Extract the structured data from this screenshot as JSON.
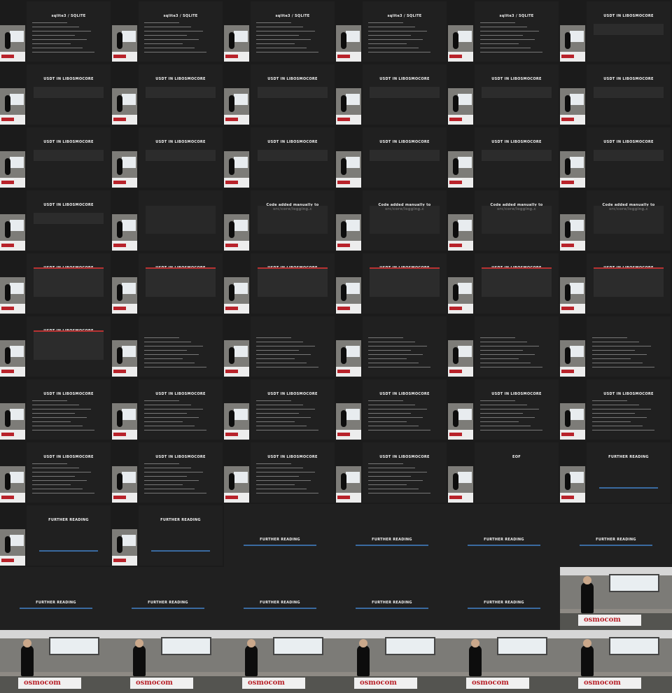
{
  "colors": {
    "background": "#111111",
    "slide": "#202020",
    "code_block": "#2c2c2c",
    "accent_red": "#b8222a",
    "link_blue": "#3a6aa0"
  },
  "labels": {
    "sqlite": "sqlite3 / SQLITE",
    "libosmocore": "USDT IN LIBOSMOCORE",
    "manual": "Code added manually to src/core/logging.c",
    "eof": "EOF",
    "further": "FURTHER READING",
    "event_logo": "osmocom"
  },
  "grid": {
    "columns": 6,
    "rows": 11,
    "cells": [
      {
        "type": "inset",
        "slide": "sqlite"
      },
      {
        "type": "inset",
        "slide": "sqlite"
      },
      {
        "type": "inset",
        "slide": "sqlite"
      },
      {
        "type": "inset",
        "slide": "sqlite"
      },
      {
        "type": "inset",
        "slide": "sqlite"
      },
      {
        "type": "inset",
        "slide": "libosmocore"
      },
      {
        "type": "inset",
        "slide": "libosmocore"
      },
      {
        "type": "inset",
        "slide": "libosmocore"
      },
      {
        "type": "inset",
        "slide": "libosmocore"
      },
      {
        "type": "inset",
        "slide": "libosmocore"
      },
      {
        "type": "inset",
        "slide": "libosmocore"
      },
      {
        "type": "inset",
        "slide": "libosmocore"
      },
      {
        "type": "inset",
        "slide": "libosmocore"
      },
      {
        "type": "inset",
        "slide": "libosmocore"
      },
      {
        "type": "inset",
        "slide": "libosmocore"
      },
      {
        "type": "inset",
        "slide": "libosmocore"
      },
      {
        "type": "inset",
        "slide": "libosmocore"
      },
      {
        "type": "inset",
        "slide": "libosmocore"
      },
      {
        "type": "inset",
        "slide": "libosmocore"
      },
      {
        "type": "inset",
        "slide": "code_dim"
      },
      {
        "type": "inset",
        "slide": "manual"
      },
      {
        "type": "inset",
        "slide": "manual"
      },
      {
        "type": "inset",
        "slide": "manual"
      },
      {
        "type": "inset",
        "slide": "manual"
      },
      {
        "type": "inset",
        "slide": "libosmocore_red"
      },
      {
        "type": "inset",
        "slide": "libosmocore_red"
      },
      {
        "type": "inset",
        "slide": "libosmocore_red"
      },
      {
        "type": "inset",
        "slide": "libosmocore_red"
      },
      {
        "type": "inset",
        "slide": "libosmocore_red"
      },
      {
        "type": "inset",
        "slide": "libosmocore_red"
      },
      {
        "type": "inset",
        "slide": "libosmocore_red"
      },
      {
        "type": "inset",
        "slide": "plain_code"
      },
      {
        "type": "inset",
        "slide": "plain_code"
      },
      {
        "type": "inset",
        "slide": "plain_code"
      },
      {
        "type": "inset",
        "slide": "plain_code"
      },
      {
        "type": "inset",
        "slide": "plain_code"
      },
      {
        "type": "inset",
        "slide": "libosmocore_plain"
      },
      {
        "type": "inset",
        "slide": "libosmocore_plain"
      },
      {
        "type": "inset",
        "slide": "libosmocore_plain"
      },
      {
        "type": "inset",
        "slide": "libosmocore_plain"
      },
      {
        "type": "inset",
        "slide": "libosmocore_plain"
      },
      {
        "type": "inset",
        "slide": "libosmocore_plain"
      },
      {
        "type": "inset",
        "slide": "libosmocore_plain"
      },
      {
        "type": "inset",
        "slide": "libosmocore_plain"
      },
      {
        "type": "inset",
        "slide": "libosmocore_plain"
      },
      {
        "type": "inset",
        "slide": "libosmocore_plain"
      },
      {
        "type": "inset",
        "slide": "eof"
      },
      {
        "type": "inset",
        "slide": "further"
      },
      {
        "type": "inset",
        "slide": "further"
      },
      {
        "type": "inset",
        "slide": "further"
      },
      {
        "type": "full",
        "slide": "further"
      },
      {
        "type": "full",
        "slide": "further"
      },
      {
        "type": "full",
        "slide": "further"
      },
      {
        "type": "full",
        "slide": "further"
      },
      {
        "type": "full",
        "slide": "further"
      },
      {
        "type": "full",
        "slide": "further"
      },
      {
        "type": "full",
        "slide": "further"
      },
      {
        "type": "full",
        "slide": "further"
      },
      {
        "type": "full",
        "slide": "further"
      },
      {
        "type": "video"
      },
      {
        "type": "video"
      },
      {
        "type": "video"
      },
      {
        "type": "video"
      },
      {
        "type": "video"
      },
      {
        "type": "video"
      },
      {
        "type": "video"
      }
    ]
  }
}
